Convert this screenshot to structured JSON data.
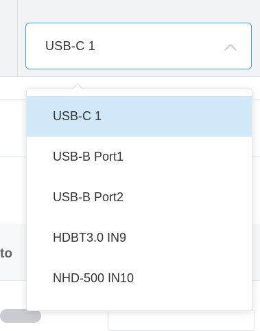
{
  "background": {
    "cut_label": "to"
  },
  "select": {
    "value": "USB-C 1",
    "icon": "chevron-up-icon",
    "border_color": "#409eff"
  },
  "dropdown": {
    "options": [
      {
        "label": "USB-C 1",
        "selected": true
      },
      {
        "label": "USB-B Port1",
        "selected": false
      },
      {
        "label": "USB-B Port2",
        "selected": false
      },
      {
        "label": "HDBT3.0 IN9",
        "selected": false
      },
      {
        "label": "NHD-500 IN10",
        "selected": false
      }
    ],
    "selected_background": "#d0e8f8"
  }
}
